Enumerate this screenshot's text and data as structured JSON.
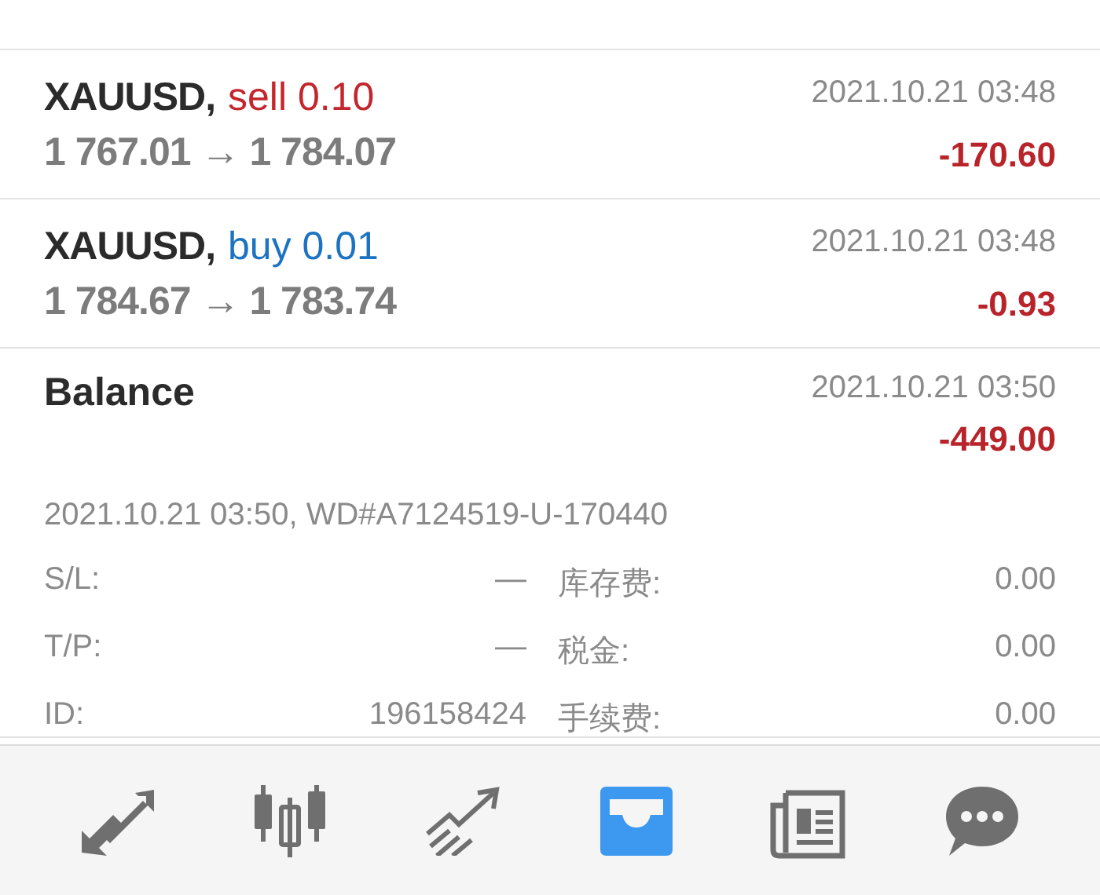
{
  "deals": [
    {
      "symbol": "XAUUSD,",
      "order": "sell 0.10",
      "color": "#c3262c",
      "time": "2021.10.21 03:48",
      "prices": "1 767.01 → 1 784.07",
      "profit": "-170.60"
    },
    {
      "symbol": "XAUUSD,",
      "order": "buy 0.01",
      "color": "#1c73c2",
      "time": "2021.10.21 03:48",
      "prices": "1 784.67 → 1 783.74",
      "profit": "-0.93"
    }
  ],
  "balance": {
    "title": "Balance",
    "time": "2021.10.21 03:50",
    "amount": "-449.00",
    "comment": "2021.10.21 03:50, WD#A7124519-U-170440",
    "details": [
      {
        "label": "S/L:",
        "value": "—",
        "label2": "库存费:",
        "value2": "0.00"
      },
      {
        "label": "T/P:",
        "value": "—",
        "label2": "税金:",
        "value2": "0.00"
      },
      {
        "label": "ID:",
        "value": "196158424",
        "label2": "手续费:",
        "value2": "0.00"
      }
    ]
  },
  "nav": [
    {
      "kind": "trade",
      "selected": false
    },
    {
      "kind": "candles",
      "selected": false
    },
    {
      "kind": "chart",
      "selected": false
    },
    {
      "kind": "history",
      "selected": true
    },
    {
      "kind": "news",
      "selected": false
    },
    {
      "kind": "chat",
      "selected": false
    }
  ]
}
